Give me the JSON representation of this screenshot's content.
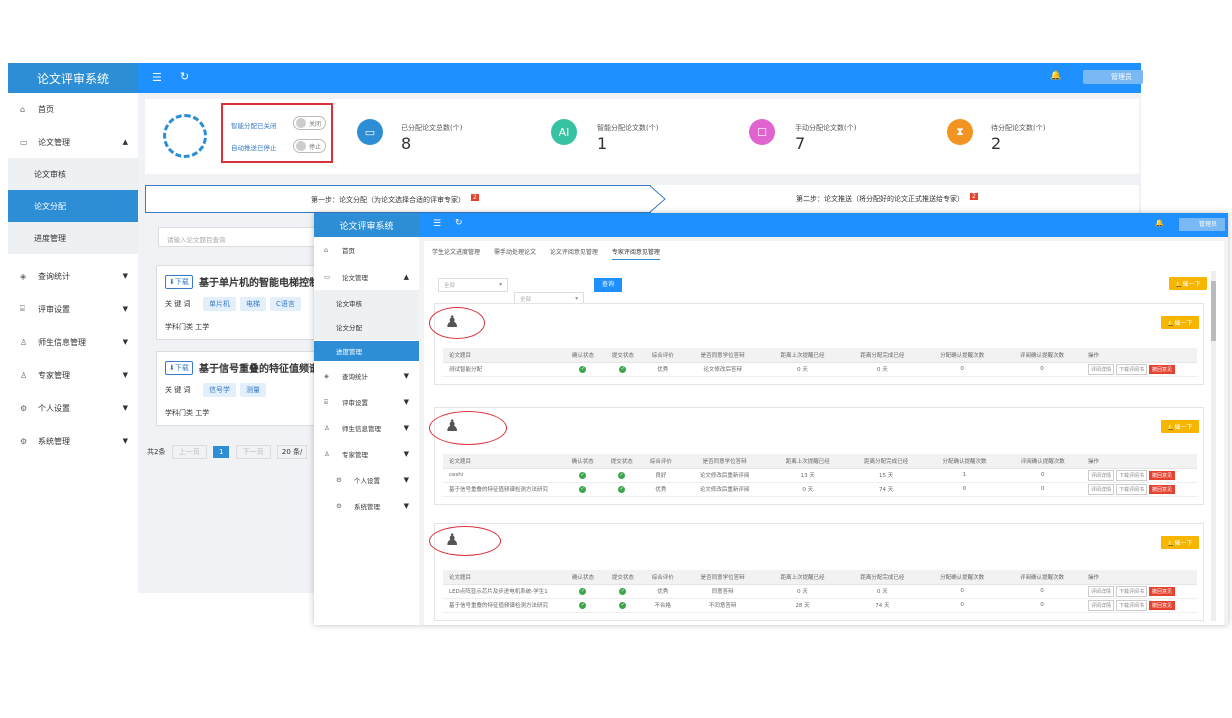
{
  "back": {
    "app_title": "论文评审系统",
    "user_label": "管理员",
    "menu": [
      {
        "label": "首页"
      },
      {
        "label": "论文管理"
      },
      {
        "label": "论文审核"
      },
      {
        "label": "论文分配"
      },
      {
        "label": "进度管理"
      },
      {
        "label": "查询统计"
      },
      {
        "label": "评审设置"
      },
      {
        "label": "师生信息管理"
      },
      {
        "label": "专家管理"
      },
      {
        "label": "个人设置"
      },
      {
        "label": "系统管理"
      }
    ],
    "auto": {
      "smart_label": "智能分配已关闭",
      "smart_toggle": "关闭",
      "push_label": "自动推送已停止",
      "push_toggle": "停止"
    },
    "stats": [
      {
        "label": "已分配论文总数(个)",
        "value": "8",
        "color": "#2d8ed6"
      },
      {
        "label": "智能分配论文数(个)",
        "value": "1",
        "color": "#37c3a2"
      },
      {
        "label": "手动分配论文数(个)",
        "value": "7",
        "color": "#e063d0"
      },
      {
        "label": "待分配论文数(个)",
        "value": "2",
        "color": "#f39321"
      }
    ],
    "steps": {
      "step1": "第一步：论文分配（为论文选择合适的评审专家）",
      "step1_badge": "2",
      "step2": "第二步：论文推送（将分配好的论文正式推送给专家）",
      "step2_badge": "2"
    },
    "search_placeholder": "请输入论文题目查询",
    "papers": [
      {
        "dl": "下载",
        "title": "基于单片机的智能电梯控制",
        "kw_label": "关 键 词",
        "keywords": [
          "单片机",
          "电梯",
          "C语言"
        ],
        "subject": "学科门类  工学"
      },
      {
        "dl": "下载",
        "title": "基于信号重叠的特征值频谱",
        "kw_label": "关 键 词",
        "keywords": [
          "信号学",
          "测量"
        ],
        "subject": "学科门类  工学"
      }
    ],
    "pagination": {
      "total": "共2条",
      "prev": "上一页",
      "page": "1",
      "next": "下一页",
      "size": "20 条/"
    }
  },
  "front": {
    "app_title": "论文评审系统",
    "user_label": "管理员",
    "menu": [
      {
        "label": "首页"
      },
      {
        "label": "论文管理"
      },
      {
        "label": "论文审核"
      },
      {
        "label": "论文分配"
      },
      {
        "label": "进度管理"
      },
      {
        "label": "查询统计"
      },
      {
        "label": "评审设置"
      },
      {
        "label": "师生信息管理"
      },
      {
        "label": "专家管理"
      },
      {
        "label": "个人设置"
      },
      {
        "label": "系统管理"
      }
    ],
    "tabs": [
      "学生论文进度管理",
      "需手动处理论文",
      "论文评阅意见管理",
      "专家评阅意见管理"
    ],
    "filter1": "全部",
    "filter2": "全部",
    "query_btn": "查询",
    "remind_all": "催一下",
    "remind": "催一下",
    "headers": [
      "论文题目",
      "确认状态",
      "提交状态",
      "综合评价",
      "是否同意学位答辩",
      "距离上次提醒已经",
      "距离分配完成已经",
      "分配确认提醒次数",
      "评阅确认提醒次数",
      "操作"
    ],
    "ops": {
      "detail": "评阅详情",
      "download": "下载评阅书",
      "withdraw": "撤回意见"
    },
    "experts": [
      {
        "rows": [
          {
            "title": "测试智能分配",
            "eval": "优秀",
            "agree": "论文修改后答辩",
            "last": "0 天",
            "since": "0 天",
            "c1": "0",
            "c2": "0"
          }
        ]
      },
      {
        "rows": [
          {
            "title": "ceshi",
            "eval": "良好",
            "agree": "论文修改后重新评阅",
            "last": "13 天",
            "since": "15 天",
            "c1": "1",
            "c2": "0"
          },
          {
            "title": "基于信号重叠的特征值频谱检测方法研究",
            "eval": "优秀",
            "agree": "论文修改后重新评阅",
            "last": "0 天",
            "since": "74 天",
            "c1": "0",
            "c2": "0"
          }
        ]
      },
      {
        "rows": [
          {
            "title": "LED点阵显示芯片及步进电机系统-学生1",
            "eval": "优秀",
            "agree": "同意答辩",
            "last": "0 天",
            "since": "0 天",
            "c1": "0",
            "c2": "0"
          },
          {
            "title": "基于信号重叠的特征值频谱检测方法研究",
            "eval": "不合格",
            "agree": "不同意答辩",
            "last": "28 天",
            "since": "74 天",
            "c1": "0",
            "c2": "0"
          }
        ]
      }
    ]
  }
}
